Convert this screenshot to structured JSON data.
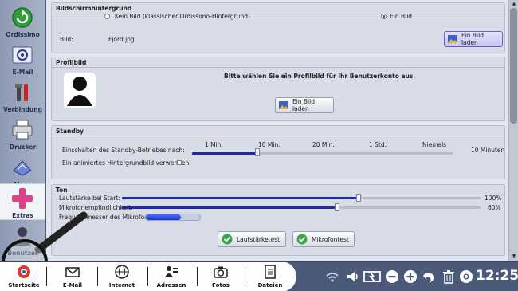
{
  "sidebar": {
    "items": [
      {
        "label": "Ordissimo"
      },
      {
        "label": "E-Mail"
      },
      {
        "label": "Verbindung"
      },
      {
        "label": "Drucker"
      },
      {
        "label": "Maus"
      },
      {
        "label": "Extras"
      },
      {
        "label": "Benutzer"
      }
    ]
  },
  "wallpaper": {
    "title": "Bildschirmhintergrund",
    "option_none": "Kein Bild (klassischer Ordissimo-Hintergrund)",
    "option_image": "Ein Bild",
    "selected": "Ein Bild",
    "image_label": "Bild:",
    "image_value": "Fjord.jpg",
    "load_button": "Ein Bild laden"
  },
  "profile": {
    "title": "Profilbild",
    "prompt": "Bitte wählen Sie ein Profilbild für Ihr Benutzerkonto aus.",
    "load_button": "Ein Bild laden"
  },
  "standby": {
    "title": "Standby",
    "label": "Einschalten des Standby-Betriebes nach:",
    "ticks": [
      "1 Min.",
      "10 Min.",
      "20 Min.",
      "1 Std.",
      "Niemals"
    ],
    "value": "10 Minuten",
    "value_fraction": 0.25,
    "animated_label": "Ein animiertes Hintergrundbild verwenden.",
    "animated_checked": false
  },
  "sound": {
    "title": "Ton",
    "volume_label": "Lautstärke bei Start:",
    "volume_value": "100%",
    "volume_fraction": 0.66,
    "mic_label": "Mikrofonempfindlichkeit:",
    "mic_value": "60%",
    "mic_fraction": 0.6,
    "mic_level_label": "Frequenzmesser des Mikrofons:",
    "mic_level_fraction": 0.65,
    "test_volume_button": "Lautstärketest",
    "test_mic_button": "Mikrofontest"
  },
  "taskbar": {
    "items": [
      {
        "label": "Startseite"
      },
      {
        "label": "E-Mail"
      },
      {
        "label": "Internet"
      },
      {
        "label": "Adressen"
      },
      {
        "label": "Fotos"
      },
      {
        "label": "Dateien"
      }
    ],
    "clock": "12:25"
  }
}
